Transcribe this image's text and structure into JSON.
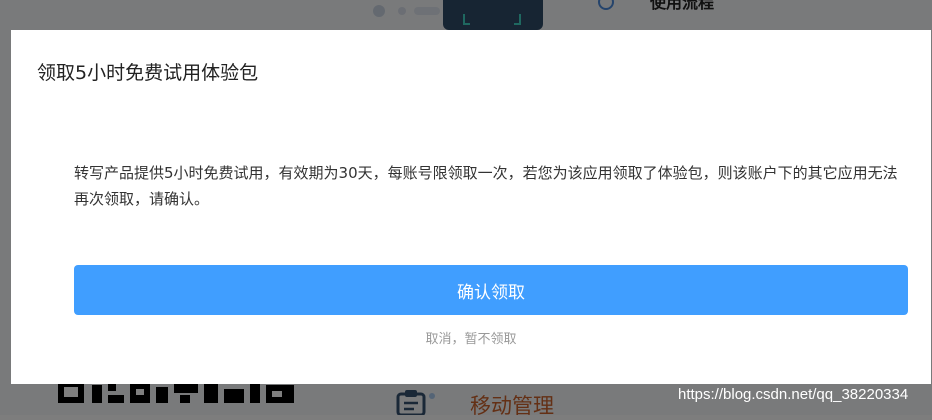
{
  "background": {
    "heading": "使用流程",
    "section_label": "移动管理",
    "watermark": "https://blog.csdn.net/qq_38220334"
  },
  "modal": {
    "title": "领取5小时免费试用体验包",
    "message": "转写产品提供5小时免费试用，有效期为30天，每账号限领取一次，若您为该应用领取了体验包，则该账户下的其它应用无法再次领取，请确认。",
    "confirm_label": "确认领取",
    "cancel_label": "取消，暂不领取"
  },
  "colors": {
    "primary": "#409eff",
    "accent_text": "#c8602a",
    "overlay": "rgba(0,0,0,0.5)"
  },
  "icons": {
    "scan": "scan-frame-icon",
    "circle": "circle-icon",
    "qr": "qr-code-icon",
    "clipboard": "clipboard-icon"
  }
}
